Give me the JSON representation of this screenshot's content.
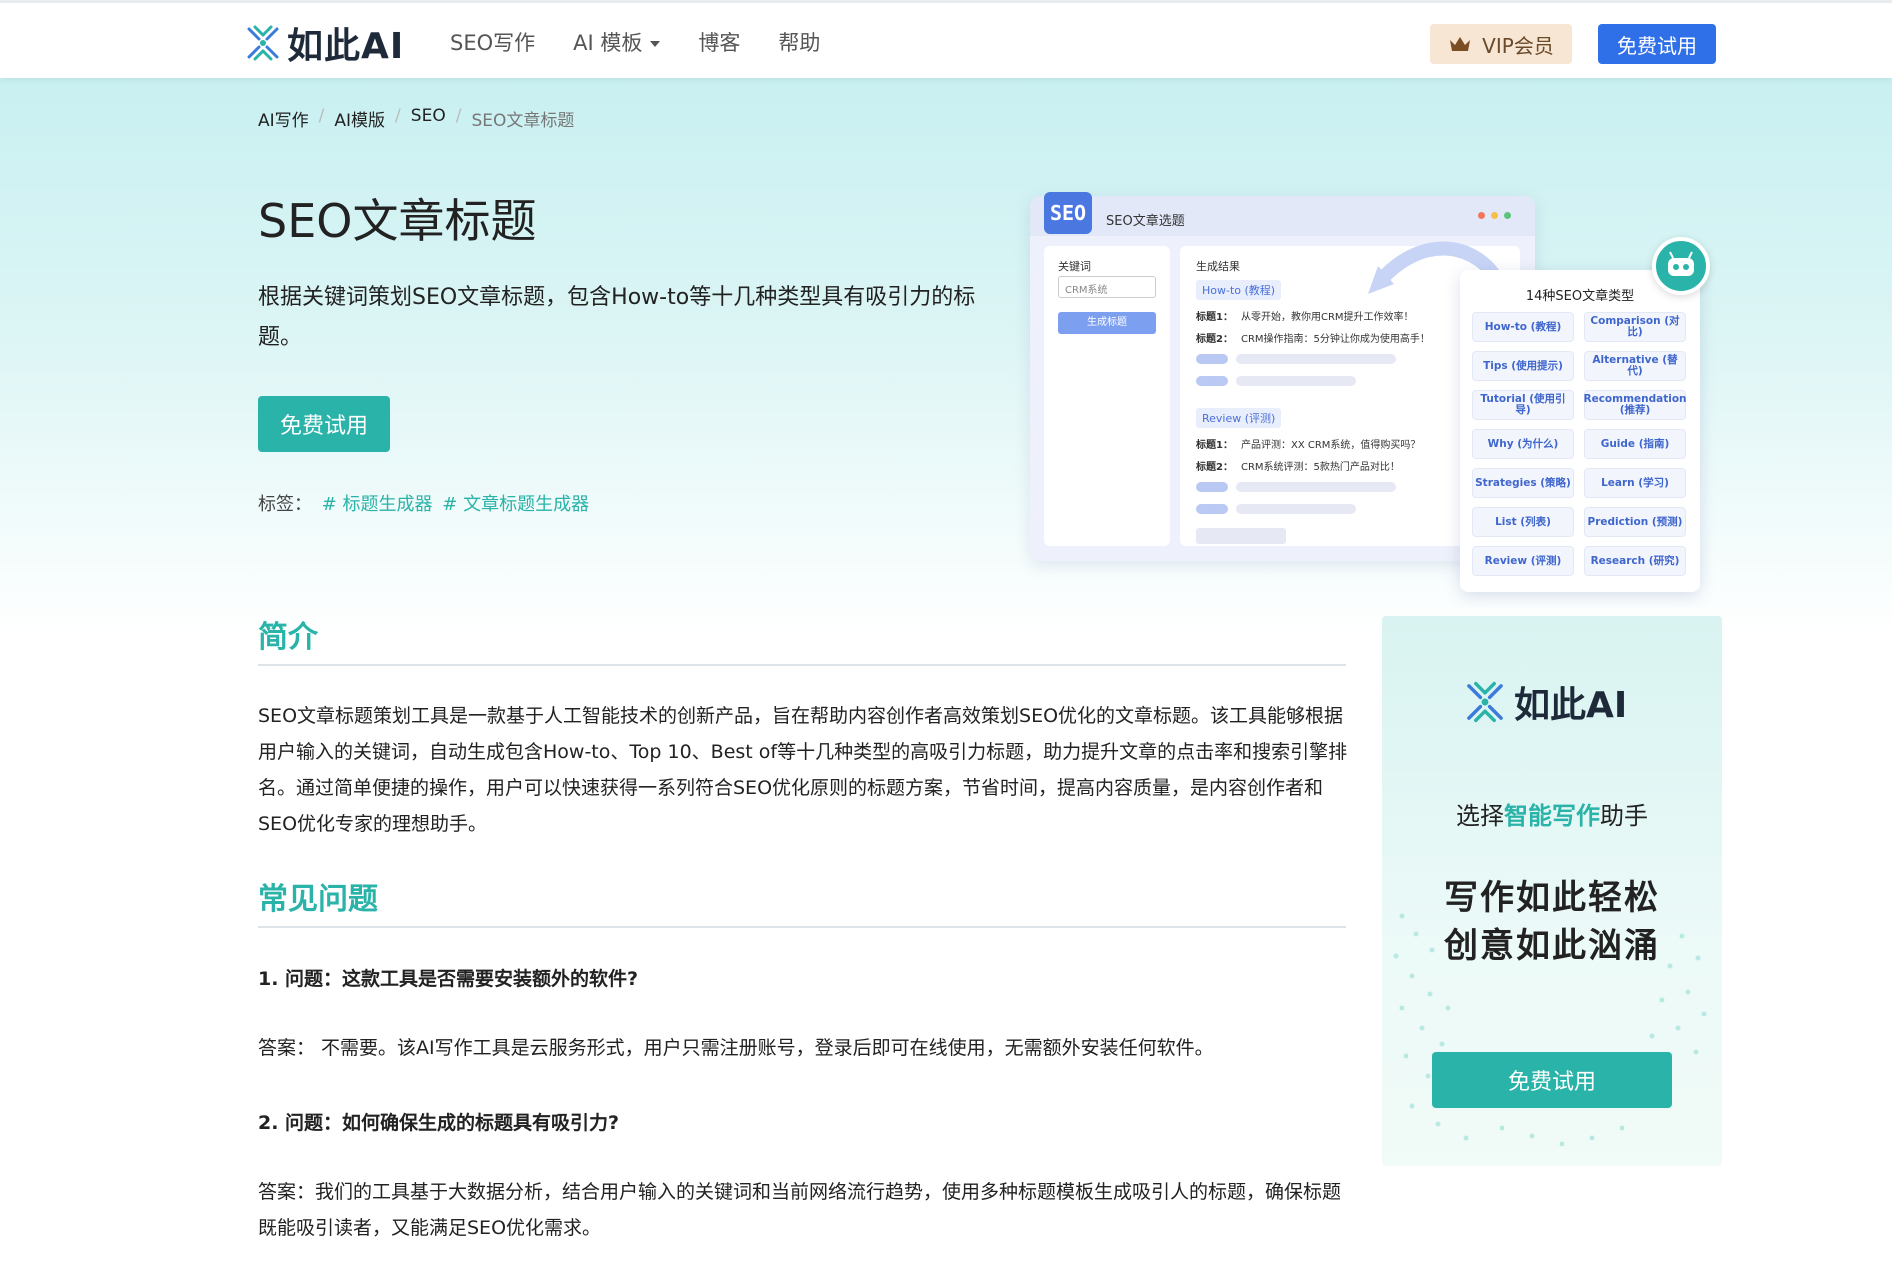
{
  "nav": {
    "logo_text": "如此AI",
    "links": [
      "SEO写作",
      "AI 模板",
      "博客",
      "帮助"
    ],
    "vip_label": "VIP会员",
    "try_label": "免费试用"
  },
  "breadcrumb": [
    "AI写作",
    "AI模版",
    "SEO",
    "SEO文章标题"
  ],
  "hero": {
    "title": "SEO文章标题",
    "description": "根据关键词策划SEO文章标题，包含How-to等十几种类型具有吸引力的标题。",
    "button": "免费试用",
    "tags_label": "标签：",
    "tags": [
      "# 标题生成器",
      "# 文章标题生成器"
    ]
  },
  "mockup": {
    "window_title": "SEO文章选题",
    "badge": "SEO",
    "keyword_label": "关键词",
    "keyword_value": "CRM系统",
    "generate_button": "生成标题",
    "result_label": "生成结果",
    "group1": {
      "chip": "How-to (教程)",
      "lines": [
        {
          "k": "标题1：",
          "v": "从零开始，教你用CRM提升工作效率！"
        },
        {
          "k": "标题2：",
          "v": "CRM操作指南：5分钟让你成为使用高手！"
        }
      ]
    },
    "group2": {
      "chip": "Review (评测)",
      "lines": [
        {
          "k": "标题1：",
          "v": "产品评测：XX CRM系统，值得购买吗？"
        },
        {
          "k": "标题2：",
          "v": "CRM系统评测：5款热门产品对比！"
        }
      ]
    },
    "types_title": "14种SEO文章类型",
    "types": [
      "How-to (教程)",
      "Comparison (对比)",
      "Tips (使用提示)",
      "Alternative (替代)",
      "Tutorial (使用引导)",
      "Recommendation (推荐)",
      "Why (为什么)",
      "Guide (指南)",
      "Strategies (策略)",
      "Learn (学习)",
      "List (列表)",
      "Prediction (预测)",
      "Review (评测)",
      "Research (研究)"
    ]
  },
  "intro": {
    "title": "简介",
    "text": "SEO文章标题策划工具是一款基于人工智能技术的创新产品，旨在帮助内容创作者高效策划SEO优化的文章标题。该工具能够根据用户输入的关键词，自动生成包含How-to、Top 10、Best of等十几种类型的高吸引力标题，助力提升文章的点击率和搜索引擎排名。通过简单便捷的操作，用户可以快速获得一系列符合SEO优化原则的标题方案，节省时间，提高内容质量，是内容创作者和SEO优化专家的理想助手。"
  },
  "faq": {
    "title": "常见问题",
    "items": [
      {
        "q": "1. 问题：这款工具是否需要安装额外的软件?",
        "a": "答案： 不需要。该AI写作工具是云服务形式，用户只需注册账号，登录后即可在线使用，无需额外安装任何软件。"
      },
      {
        "q": "2. 问题：如何确保生成的标题具有吸引力?",
        "a": "答案：我们的工具基于大数据分析，结合用户输入的关键词和当前网络流行趋势，使用多种标题模板生成吸引人的标题，确保标题既能吸引读者，又能满足SEO优化需求。"
      }
    ]
  },
  "ad": {
    "logo_text": "如此AI",
    "choose_prefix": "选择",
    "choose_highlight": "智能写作",
    "choose_suffix": "助手",
    "slogan1": "写作如此轻松",
    "slogan2": "创意如此汹涌",
    "button": "免费试用"
  },
  "colors": {
    "accent": "#2ab3a8",
    "primary_blue": "#2f6fe8",
    "vip_bg": "#f7e6d4"
  }
}
